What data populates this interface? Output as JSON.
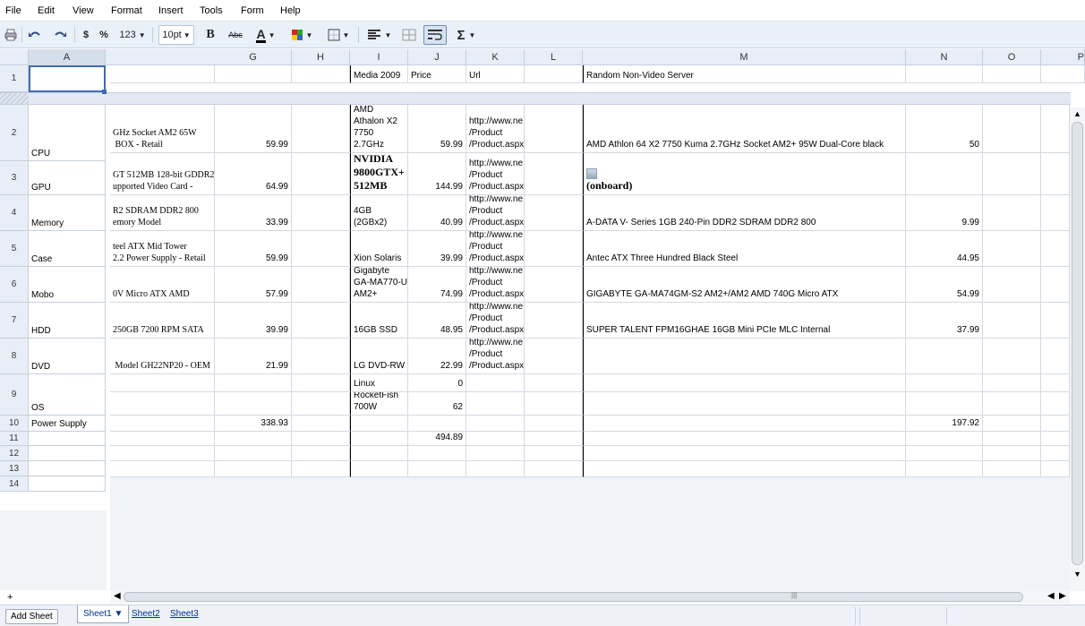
{
  "menu": [
    "File",
    "Edit",
    "View",
    "Format",
    "Insert",
    "Tools",
    "Form",
    "Help"
  ],
  "toolbar": {
    "currency": "$",
    "percent": "%",
    "numfmt": "123",
    "fontsize": "10pt",
    "bold": "B",
    "strike": "Abc",
    "fontcolor": "A",
    "sum": "Σ"
  },
  "columns": [
    "A",
    "G",
    "H",
    "I",
    "J",
    "K",
    "L",
    "M",
    "N",
    "O",
    "P"
  ],
  "rows": [
    "1",
    "2",
    "3",
    "4",
    "5",
    "6",
    "7",
    "8",
    "9",
    "10",
    "11",
    "12",
    "13",
    "14"
  ],
  "colA": [
    "",
    "CPU",
    "GPU",
    "Memory",
    "Case",
    "Mobo",
    "HDD",
    "DVD",
    "OS",
    "Power Supply",
    "",
    "",
    "",
    ""
  ],
  "header": {
    "i": "Media 2009",
    "j": "Price",
    "k": "Url",
    "m": "Random Non-Video Server"
  },
  "rowsdata": [
    {
      "f": "GHz Socket AM2 65W\n BOX - Retail",
      "g": "59.99",
      "i": "AMD\nAthalon X2\n7750\n2.7GHz",
      "j": "59.99",
      "k": "http://www.ne\n/Product\n/Product.aspx",
      "m": "AMD Athlon 64 X2 7750 Kuma 2.7GHz Socket AM2+ 95W Dual-Core black",
      "n": "50"
    },
    {
      "f": "GT 512MB 128-bit GDDR2\nupported Video Card -",
      "g": "64.99",
      "i": "NVIDIA\n9800GTX+\n512MB",
      "j": "144.99",
      "k": "http://www.ne\n/Product\n/Product.aspx",
      "m": "(onboard)",
      "n": ""
    },
    {
      "f": "R2 SDRAM DDR2 800\nemory Model",
      "g": "33.99",
      "i": "4GB\n(2GBx2)",
      "j": "40.99",
      "k": "http://www.ne\n/Product\n/Product.aspx",
      "m": "A-DATA V- Series 1GB 240-Pin DDR2 SDRAM DDR2 800",
      "n": "9.99"
    },
    {
      "f": "teel ATX Mid Tower\n2.2 Power Supply - Retail",
      "g": "59.99",
      "i": "Xion Solaris",
      "j": "39.99",
      "k": "http://www.ne\n/Product\n/Product.aspx",
      "m": "Antec ATX Three Hundred Black Steel",
      "n": "44.95"
    },
    {
      "f": "0V Micro ATX AMD",
      "g": "57.99",
      "i": "Gigabyte\nGA-MA770-U\nAM2+",
      "j": "74.99",
      "k": "http://www.ne\n/Product\n/Product.aspx",
      "m": "GIGABYTE GA-MA74GM-S2 AM2+/AM2 AMD 740G Micro ATX",
      "n": "54.99"
    },
    {
      "f": "250GB 7200 RPM SATA",
      "g": "39.99",
      "i": "16GB SSD",
      "j": "48.95",
      "k": "http://www.ne\n/Product\n/Product.aspx",
      "m": "SUPER TALENT FPM16GHAE 16GB Mini PCIe MLC Internal",
      "n": "37.99"
    },
    {
      "f": " Model GH22NP20 - OEM",
      "g": "21.99",
      "i": "LG DVD-RW",
      "j": "22.99",
      "k": "http://www.ne\n/Product\n/Product.aspx",
      "m": "",
      "n": ""
    },
    {
      "f": "",
      "g": "",
      "i": "Linux",
      "j": "0",
      "k": "",
      "m": "",
      "n": ""
    },
    {
      "f": "",
      "g": "",
      "i": "RocketFish\n700W",
      "j": "62",
      "k": "",
      "m": "",
      "n": ""
    },
    {
      "f": "",
      "g": "338.93",
      "i": "",
      "j": "",
      "k": "",
      "m": "",
      "n": "197.92"
    },
    {
      "f": "",
      "g": "",
      "i": "",
      "j": "494.89",
      "k": "",
      "m": "",
      "n": ""
    }
  ],
  "sheets": {
    "add": "Add Sheet",
    "tabs": [
      "Sheet1 ▼",
      "Sheet2",
      "Sheet3"
    ]
  },
  "plus": "+"
}
